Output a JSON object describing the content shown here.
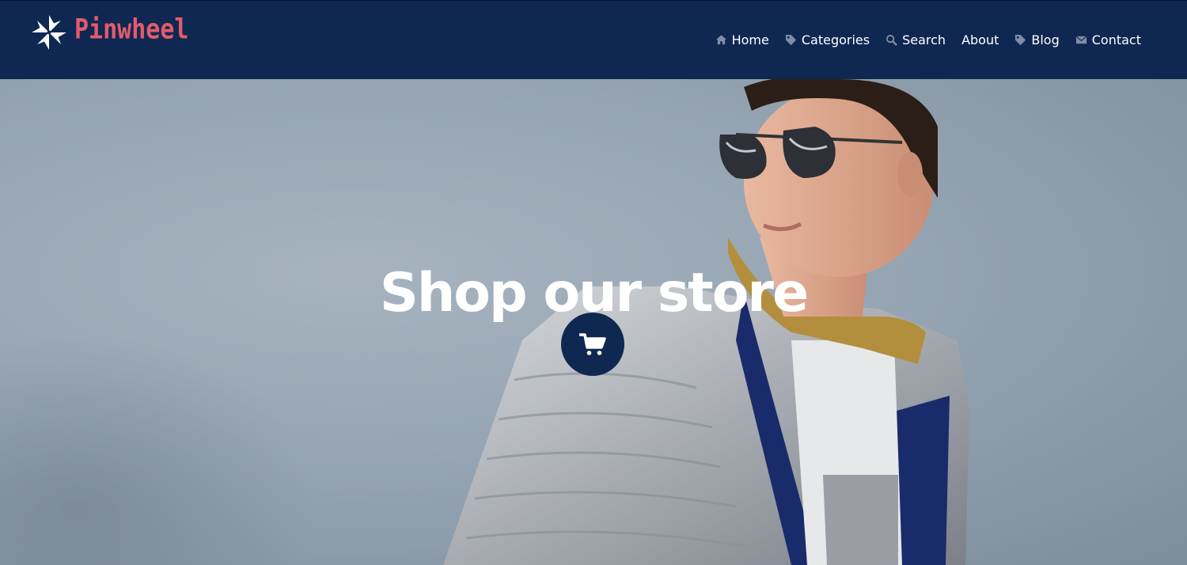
{
  "brand": {
    "name": "Pinwheel",
    "logo_icon": "pinwheel-icon",
    "name_color": "#e35b6b"
  },
  "header": {
    "background": "#0f2851"
  },
  "nav": {
    "items": [
      {
        "label": "Home",
        "icon": "home-icon"
      },
      {
        "label": "Categories",
        "icon": "tag-icon"
      },
      {
        "label": "Search",
        "icon": "search-icon"
      },
      {
        "label": "About",
        "icon": ""
      },
      {
        "label": "Blog",
        "icon": "tag-icon"
      },
      {
        "label": "Contact",
        "icon": "envelope-icon"
      }
    ]
  },
  "hero": {
    "title": "Shop our store",
    "cart_icon": "shopping-cart-icon",
    "image": "man-in-sunglasses-and-puffer-jacket"
  }
}
